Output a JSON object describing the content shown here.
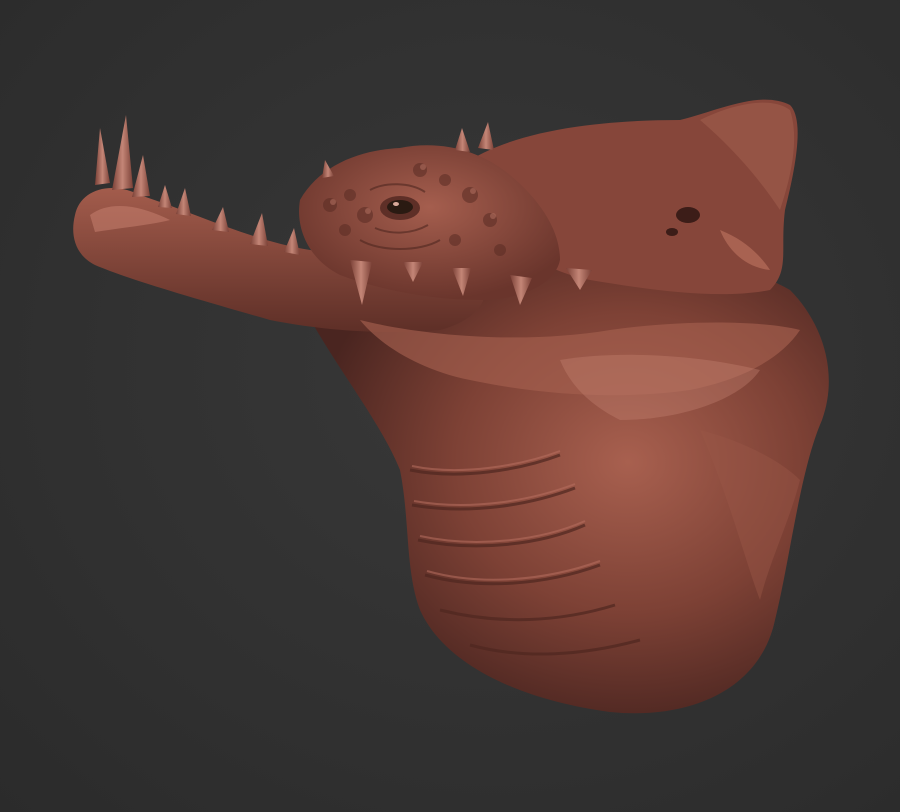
{
  "scene": {
    "background_color": "#323232",
    "material_base_color": "#8a4a40",
    "material_shadow_color": "#4a2520",
    "material_highlight_color": "#c98a7c",
    "eye_color": "#2a1a12"
  }
}
